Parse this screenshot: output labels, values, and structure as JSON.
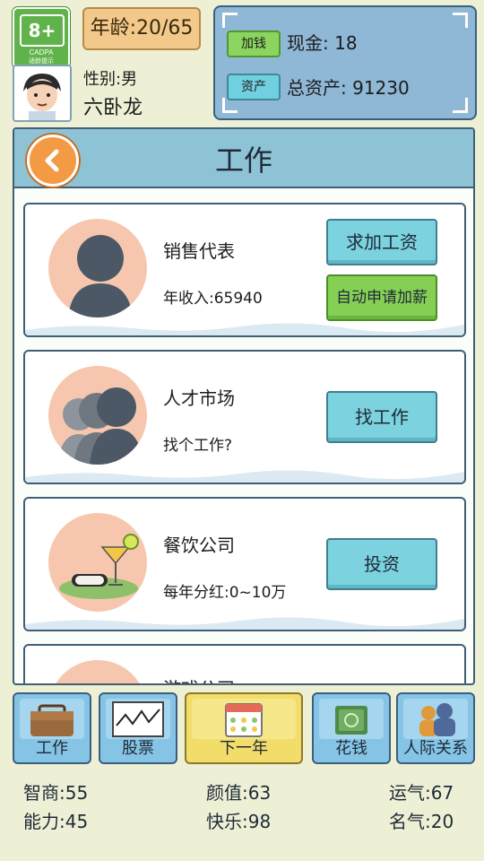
{
  "rating": {
    "age": "8+",
    "org": "CADPA",
    "tip": "适龄提示"
  },
  "player": {
    "age_text": "年龄:20/65",
    "gender": "性别:男",
    "name": "六卧龙"
  },
  "finance": {
    "earn_button": "加钱",
    "cash": "现金: 18",
    "asset_button": "资产",
    "total_assets": "总资产: 91230"
  },
  "panel": {
    "title": "工作"
  },
  "cards": [
    {
      "title": "销售代表",
      "subtitle": "年收入:65940",
      "buttons": [
        "求加工资",
        "自动申请加薪"
      ]
    },
    {
      "title": "人才市场",
      "subtitle": "找个工作?",
      "buttons": [
        "找工作"
      ]
    },
    {
      "title": "餐饮公司",
      "subtitle": "每年分红:0~10万",
      "buttons": [
        "投资"
      ]
    },
    {
      "title": "游戏公司"
    }
  ],
  "nav": [
    {
      "label": "工作",
      "icon": "briefcase-icon"
    },
    {
      "label": "股票",
      "icon": "stock-chart-icon"
    },
    {
      "label": "下一年",
      "icon": "calendar-icon"
    },
    {
      "label": "花钱",
      "icon": "money-icon"
    },
    {
      "label": "人际关系",
      "icon": "people-icon"
    }
  ],
  "stats": {
    "iq": "智商:55",
    "looks": "颜值:63",
    "luck": "运气:67",
    "ability": "能力:45",
    "happiness": "快乐:98",
    "fame": "名气:20"
  }
}
